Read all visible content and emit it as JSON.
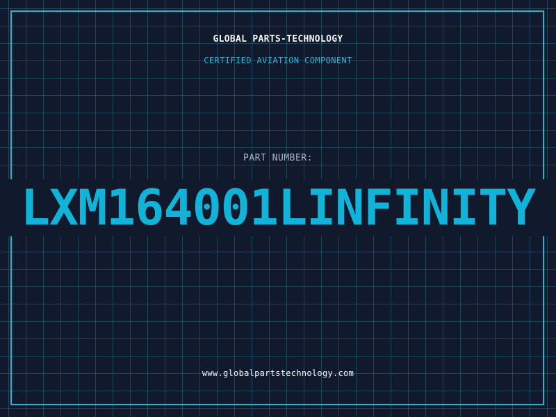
{
  "header": {
    "company": "GLOBAL PARTS-TECHNOLOGY",
    "certification": "CERTIFIED AVIATION COMPONENT"
  },
  "part": {
    "label": "PART NUMBER:",
    "number": "LXM164001LINFINITY"
  },
  "footer": {
    "website": "www.globalpartstechnology.com"
  },
  "colors": {
    "background": "#101a2c",
    "grid": "#1e6e82",
    "accent": "#12b3d8",
    "frame": "#1cb8d8",
    "text": "#f2f4f8",
    "label": "#aab6c6"
  }
}
